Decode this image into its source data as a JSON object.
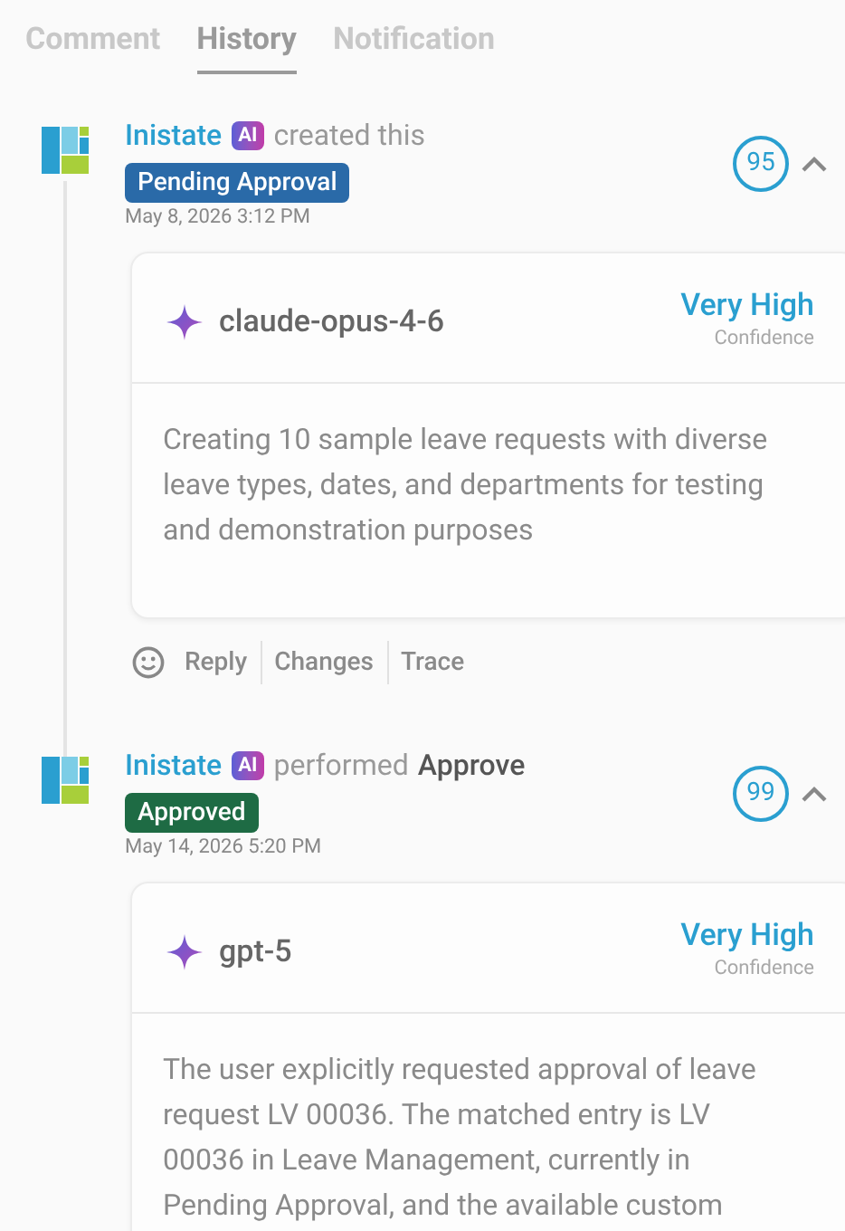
{
  "tabs": [
    {
      "label": "Comment",
      "selected": false
    },
    {
      "label": "History",
      "selected": true
    },
    {
      "label": "Notification",
      "selected": false
    }
  ],
  "events": [
    {
      "actor": "Inistate",
      "ai_badge": "AI",
      "action": [
        {
          "kind": "plain",
          "text": "created this"
        }
      ],
      "status": {
        "label": "Pending Approval",
        "color": "#2a6aa8"
      },
      "date": "May 8, 2026 3:12 PM",
      "score": "95",
      "expanded": true,
      "card": {
        "model": "claude-opus-4-6",
        "confidence": "Very High",
        "confidence_label": "Confidence",
        "text": "Creating 10 sample leave requests with diverse leave types, dates, and departments for testing and demonstration purposes"
      },
      "actions": [
        "Reply",
        "Changes",
        "Trace"
      ]
    },
    {
      "actor": "Inistate",
      "ai_badge": "AI",
      "action": [
        {
          "kind": "plain",
          "text": "performed"
        },
        {
          "kind": "strong",
          "text": "Approve"
        }
      ],
      "status": {
        "label": "Approved",
        "color": "#1e6b44"
      },
      "date": "May 14, 2026 5:20 PM",
      "score": "99",
      "expanded": true,
      "card": {
        "model": "gpt-5",
        "confidence": "Very High",
        "confidence_label": "Confidence",
        "text": "The user explicitly requested approval of leave request LV 00036. The matched entry is LV 00036 in Leave Management, currently in Pending Approval, and the available custom"
      }
    }
  ]
}
